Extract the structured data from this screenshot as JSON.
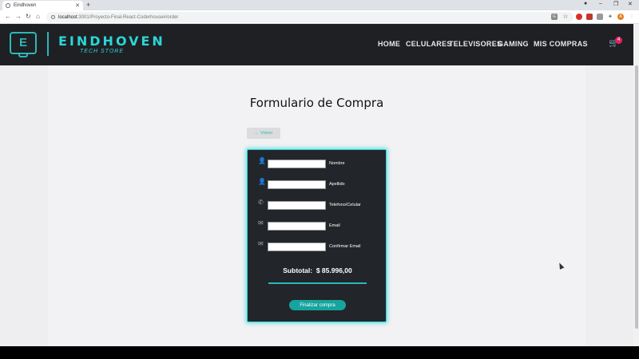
{
  "browser": {
    "tab_title": "Eindhoven",
    "url_host": "localhost",
    "url_path": ":3001/Proyecto-Final-React-Coderhouse#/order",
    "profile_initial": "A"
  },
  "site": {
    "logo_letter": "E",
    "brand": "EINDHOVEN",
    "tagline": "TECH STORE",
    "nav": [
      "HOME",
      "CELULARES",
      "TELEVISORES",
      "GAMING",
      "MIS COMPRAS"
    ],
    "cart_count": "4"
  },
  "page": {
    "title": "Formulario de Compra",
    "back_label": "Volver"
  },
  "form": {
    "fields": [
      {
        "label": "Nombre",
        "icon": "user-icon",
        "value": ""
      },
      {
        "label": "Apellido",
        "icon": "user-icon",
        "value": ""
      },
      {
        "label": "Telefono/Celular",
        "icon": "phone-icon",
        "value": ""
      },
      {
        "label": "Email",
        "icon": "mail-icon",
        "value": ""
      },
      {
        "label": "Confirmar Email",
        "icon": "mail-icon",
        "value": ""
      }
    ],
    "subtotal_label": "Subtotal:",
    "subtotal_value": "$ 85.996,00",
    "submit_label": "Finalizar compra"
  },
  "colors": {
    "accent": "#2bd6d6",
    "button": "#17a49f",
    "header_bg": "#1f2024",
    "card_bg": "#22252a"
  }
}
